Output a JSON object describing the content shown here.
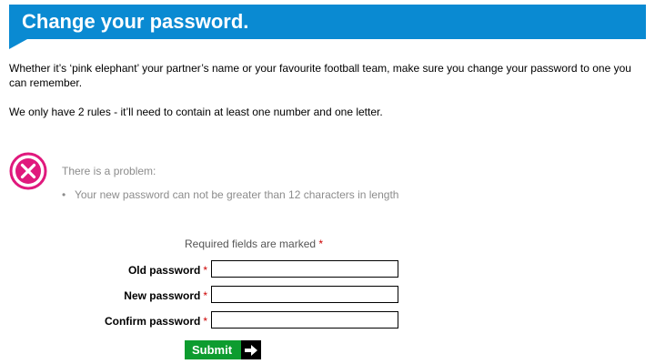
{
  "header": {
    "title": "Change your password."
  },
  "intro": {
    "text": "Whether it’s ‘pink elephant’ your partner’s name or your favourite football team, make sure you change your password to one you can remember.",
    "rules": "We only have 2 rules - it’ll need to contain at least one number and one letter."
  },
  "error": {
    "icon": "close-circle-icon",
    "heading": "There is a problem:",
    "messages": [
      "Your new password can not be greater than 12 characters in length"
    ]
  },
  "form": {
    "required_note": "Required fields are marked",
    "required_marker": "*",
    "fields": [
      {
        "label": "Old password",
        "value": ""
      },
      {
        "label": "New password",
        "value": ""
      },
      {
        "label": "Confirm password",
        "value": ""
      }
    ],
    "submit_label": "Submit",
    "submit_icon": "arrow-right-icon"
  },
  "colors": {
    "banner": "#0a8ad2",
    "error_accent": "#e0197d",
    "submit": "#0d9c2f",
    "required": "#cc0000"
  }
}
